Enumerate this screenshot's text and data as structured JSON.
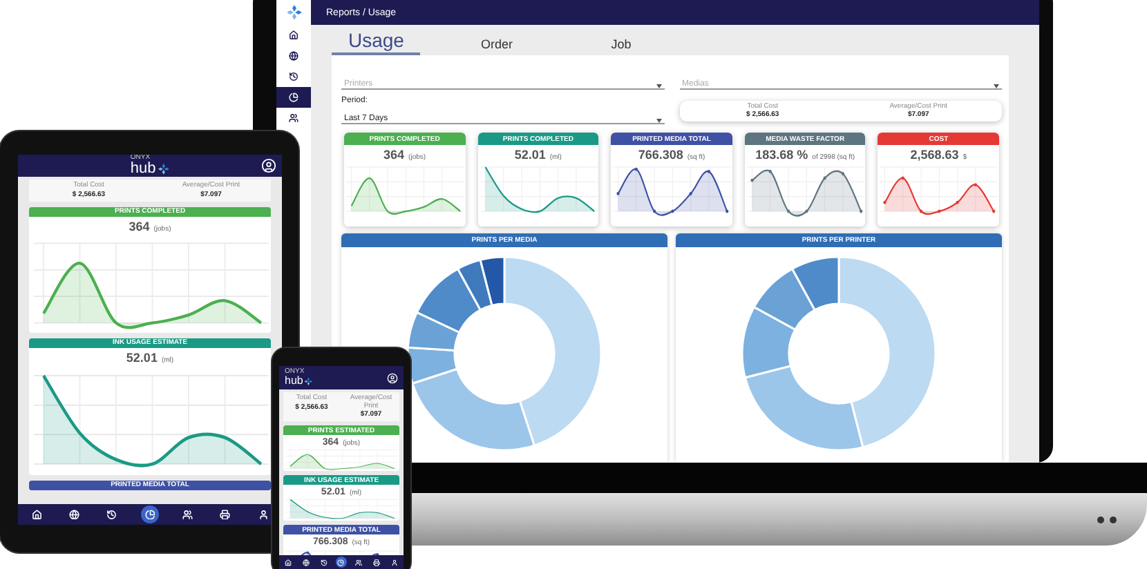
{
  "laptop": {
    "sidebar": {
      "items": [
        {
          "kind": "home",
          "selected": false
        },
        {
          "kind": "globe",
          "selected": false
        },
        {
          "kind": "history",
          "selected": false
        },
        {
          "kind": "chart",
          "selected": true
        },
        {
          "kind": "people",
          "selected": false
        }
      ]
    },
    "breadcrumb": "Reports / Usage",
    "tabs": [
      {
        "label": "Usage",
        "selected": true
      },
      {
        "label": "Order",
        "selected": false
      },
      {
        "label": "Job",
        "selected": false
      }
    ],
    "filters": {
      "printers": {
        "placeholder": "Printers"
      },
      "medias": {
        "placeholder": "Medias"
      },
      "period": {
        "label": "Period:",
        "value": "Last 7 Days"
      }
    },
    "summary": [
      {
        "label": "Total Cost",
        "value": "$ 2,566.63"
      },
      {
        "label": "Average/Cost Print",
        "value": "$7.097"
      }
    ],
    "metrics": [
      {
        "title": "PRINTS COMPLETED",
        "value": "364",
        "unit": "(jobs)",
        "color": "#4caf50"
      },
      {
        "title": "PRINTS COMPLETED",
        "value": "52.01",
        "unit": "(ml)",
        "color": "#1a9a86"
      },
      {
        "title": "PRINTED MEDIA TOTAL",
        "value": "766.308",
        "unit": "(sq ft)",
        "color": "#3f51a5"
      },
      {
        "title": "MEDIA WASTE FACTOR",
        "value": "183.68 %",
        "unit": "of 2998 (sq ft)",
        "color": "#5d7580"
      },
      {
        "title": "COST",
        "value": "2,568.63",
        "unit": "$",
        "color": "#e53935"
      }
    ],
    "donuts": [
      {
        "title": "PRINTS PER MEDIA"
      },
      {
        "title": "PRINTS PER PRINTER"
      }
    ]
  },
  "tablet": {
    "header": {
      "brand_small": "ONYX",
      "brand": "hub"
    },
    "summary": [
      {
        "label": "Total Cost",
        "value": "$ 2,566.63"
      },
      {
        "label": "Average/Cost Print",
        "value": "$7.097"
      }
    ],
    "panels": [
      {
        "title": "PRINTS COMPLETED",
        "value": "364",
        "unit": "(jobs)",
        "color": "#4caf50"
      },
      {
        "title": "INK USAGE ESTIMATE",
        "value": "52.01",
        "unit": "(ml)",
        "color": "#1a9a86"
      },
      {
        "title": "PRINTED MEDIA TOTAL",
        "color": "#3f51a5"
      }
    ],
    "nav": [
      {
        "kind": "home",
        "selected": false
      },
      {
        "kind": "globe",
        "selected": false
      },
      {
        "kind": "history",
        "selected": false
      },
      {
        "kind": "chart",
        "selected": true
      },
      {
        "kind": "people",
        "selected": false
      },
      {
        "kind": "printer",
        "selected": false
      },
      {
        "kind": "user",
        "selected": false
      }
    ]
  },
  "phone": {
    "header": {
      "brand_small": "ONYX",
      "brand": "hub"
    },
    "summary": [
      {
        "label": "Total Cost",
        "value": "$ 2,566.63"
      },
      {
        "label": "Average/Cost Print",
        "value": "$7.097"
      }
    ],
    "panels": [
      {
        "title": "PRINTS ESTIMATED",
        "value": "364",
        "unit": "(jobs)",
        "color": "#4caf50"
      },
      {
        "title": "INK USAGE ESTIMATE",
        "value": "52.01",
        "unit": "(ml)",
        "color": "#1a9a86"
      },
      {
        "title": "PRINTED MEDIA TOTAL",
        "value": "766.308",
        "unit": "(sq ft)",
        "color": "#3f51a5"
      }
    ],
    "nav": [
      {
        "kind": "home",
        "selected": false
      },
      {
        "kind": "globe",
        "selected": false
      },
      {
        "kind": "history",
        "selected": false
      },
      {
        "kind": "chart",
        "selected": true
      },
      {
        "kind": "people",
        "selected": false
      },
      {
        "kind": "printer",
        "selected": false
      },
      {
        "kind": "user",
        "selected": false
      }
    ]
  }
}
